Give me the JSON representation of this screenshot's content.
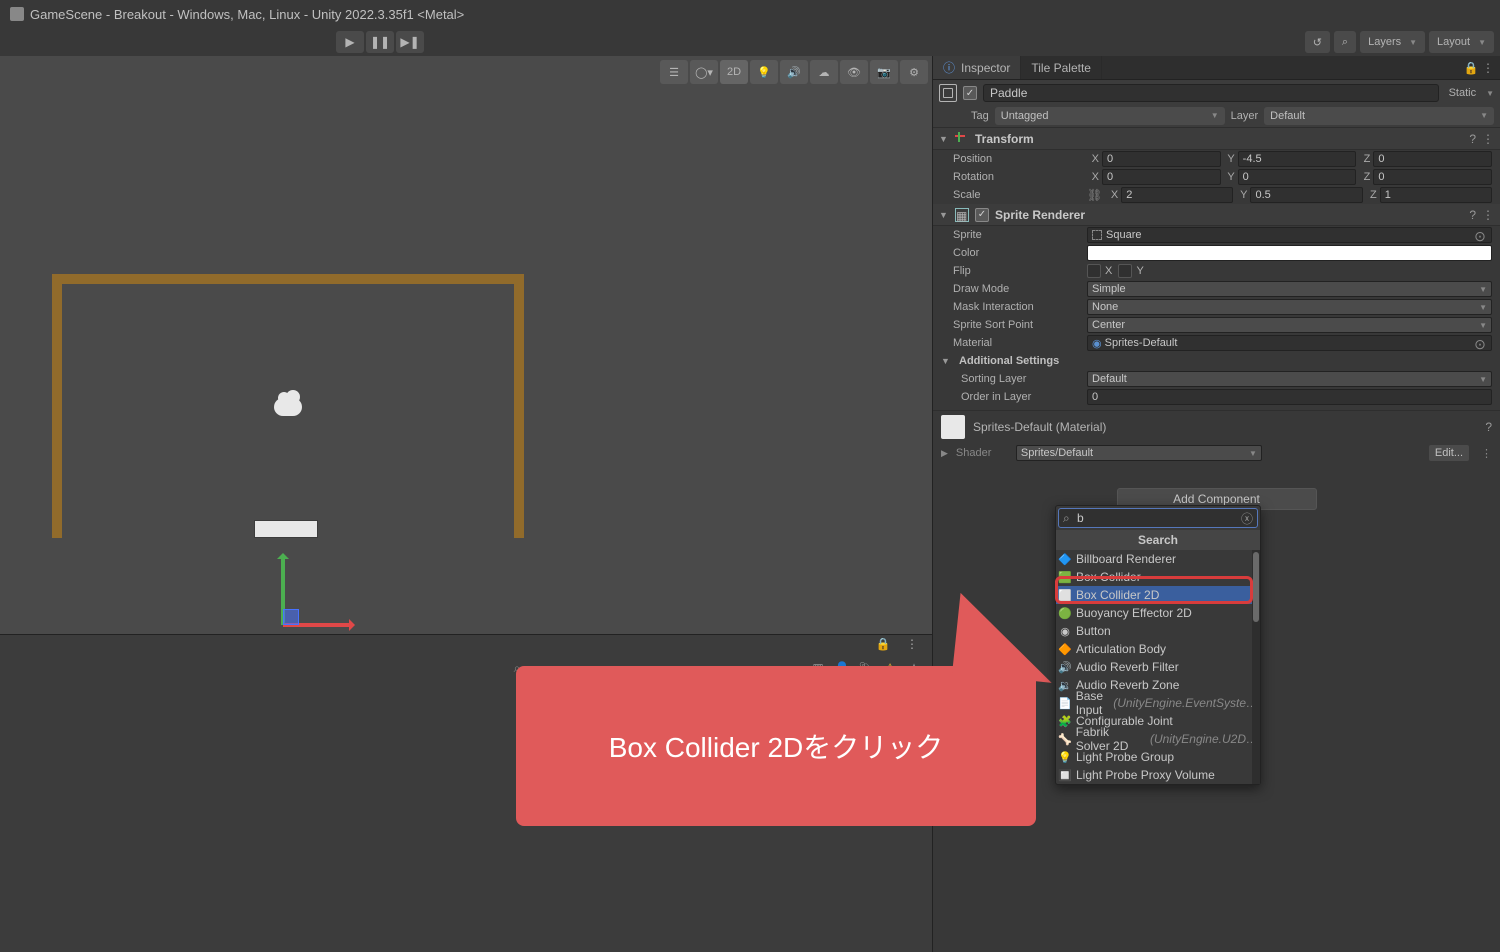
{
  "window_title": "GameScene - Breakout - Windows, Mac, Linux - Unity 2022.3.35f1 <Metal>",
  "top_right": {
    "layers": "Layers",
    "layout": "Layout"
  },
  "scene_toolbar": {
    "mode_2d": "2D"
  },
  "tabs": {
    "inspector": "Inspector",
    "tile_palette": "Tile Palette"
  },
  "gameobject": {
    "name": "Paddle",
    "static_label": "Static",
    "tag_label": "Tag",
    "tag_value": "Untagged",
    "layer_label": "Layer",
    "layer_value": "Default"
  },
  "transform": {
    "title": "Transform",
    "position_label": "Position",
    "position": {
      "x": "0",
      "y": "-4.5",
      "z": "0"
    },
    "rotation_label": "Rotation",
    "rotation": {
      "x": "0",
      "y": "0",
      "z": "0"
    },
    "scale_label": "Scale",
    "scale": {
      "x": "2",
      "y": "0.5",
      "z": "1"
    }
  },
  "sprite_renderer": {
    "title": "Sprite Renderer",
    "sprite_label": "Sprite",
    "sprite_value": "Square",
    "color_label": "Color",
    "flip_label": "Flip",
    "flip_x": "X",
    "flip_y": "Y",
    "draw_mode_label": "Draw Mode",
    "draw_mode_value": "Simple",
    "mask_interaction_label": "Mask Interaction",
    "mask_interaction_value": "None",
    "sort_point_label": "Sprite Sort Point",
    "sort_point_value": "Center",
    "material_label": "Material",
    "material_value": "Sprites-Default",
    "additional_label": "Additional Settings",
    "sorting_layer_label": "Sorting Layer",
    "sorting_layer_value": "Default",
    "order_label": "Order in Layer",
    "order_value": "0"
  },
  "material_block": {
    "name": "Sprites-Default (Material)",
    "shader_label": "Shader",
    "shader_value": "Sprites/Default",
    "edit_label": "Edit..."
  },
  "add_component": "Add Component",
  "search_popup": {
    "query": "b",
    "heading": "Search",
    "items": [
      {
        "label": "Billboard Renderer",
        "icon": "🔷",
        "dim": ""
      },
      {
        "label": "Box Collider",
        "icon": "🟩",
        "dim": ""
      },
      {
        "label": "Box Collider 2D",
        "icon": "⬜",
        "dim": "",
        "selected": true
      },
      {
        "label": "Buoyancy Effector 2D",
        "icon": "🟢",
        "dim": ""
      },
      {
        "label": "Button",
        "icon": "◉",
        "dim": ""
      },
      {
        "label": "Articulation Body",
        "icon": "🔶",
        "dim": ""
      },
      {
        "label": "Audio Reverb Filter",
        "icon": "🔊",
        "dim": ""
      },
      {
        "label": "Audio Reverb Zone",
        "icon": "🔉",
        "dim": ""
      },
      {
        "label": "Base Input",
        "icon": "📄",
        "dim": "(UnityEngine.EventSyste…"
      },
      {
        "label": "Configurable Joint",
        "icon": "🧩",
        "dim": ""
      },
      {
        "label": "Fabrik Solver 2D",
        "icon": "🦴",
        "dim": "(UnityEngine.U2D…"
      },
      {
        "label": "Light Probe Group",
        "icon": "💡",
        "dim": ""
      },
      {
        "label": "Light Probe Proxy Volume",
        "icon": "🔲",
        "dim": ""
      }
    ]
  },
  "callout_text": "Box Collider 2Dをクリック"
}
